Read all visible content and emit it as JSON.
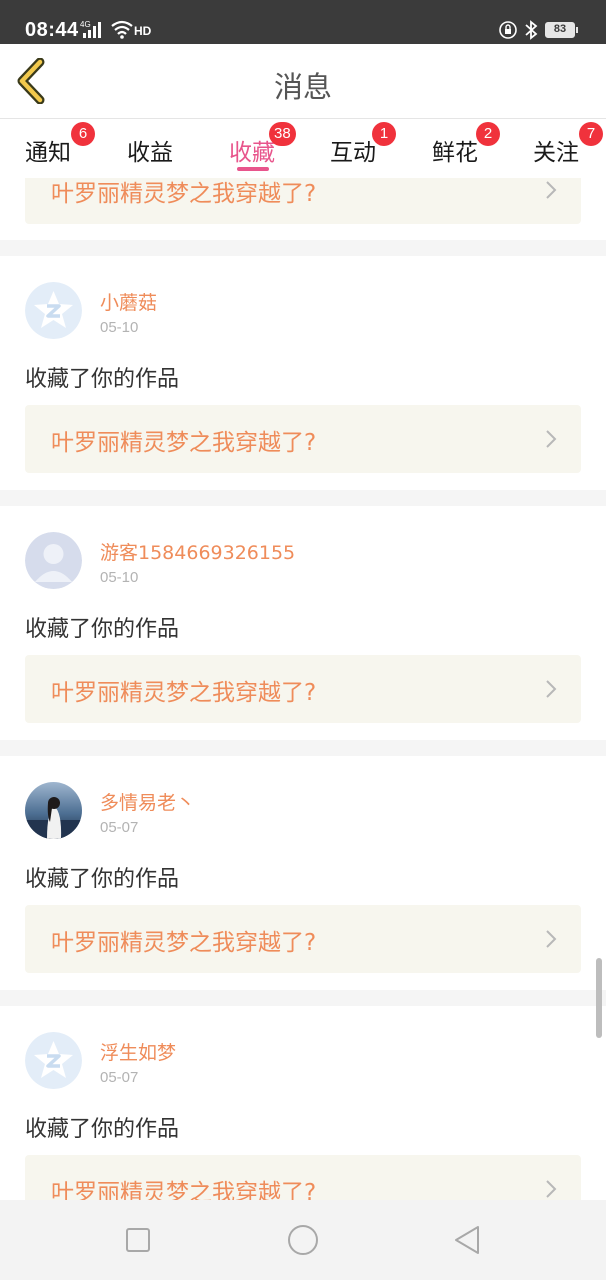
{
  "status_bar": {
    "time": "08:44",
    "network": "4G",
    "hd_label": "HD",
    "battery": "83",
    "icons": [
      "signal-icon",
      "wifi-icon",
      "rotation-lock-icon",
      "bluetooth-icon",
      "battery-icon"
    ]
  },
  "header": {
    "title": "消息",
    "back_icon": "back-chevron-icon"
  },
  "tabs": [
    {
      "label": "通知",
      "badge": "6",
      "active": false
    },
    {
      "label": "收益",
      "badge": "",
      "active": false
    },
    {
      "label": "收藏",
      "badge": "38",
      "active": true
    },
    {
      "label": "互动",
      "badge": "1",
      "active": false
    },
    {
      "label": "鲜花",
      "badge": "2",
      "active": false
    },
    {
      "label": "关注",
      "badge": "7",
      "active": false
    }
  ],
  "top_partial_item": {
    "work_title": "叶罗丽精灵梦之我穿越了?"
  },
  "items": [
    {
      "user": "小蘑菇",
      "date": "05-10",
      "action": "收藏了你的作品",
      "work_title": "叶罗丽精灵梦之我穿越了?",
      "avatar": "default-star-avatar"
    },
    {
      "user": "游客1584669326155",
      "date": "05-10",
      "action": "收藏了你的作品",
      "work_title": "叶罗丽精灵梦之我穿越了?",
      "avatar": "default-person-avatar"
    },
    {
      "user": "多情易老丶",
      "date": "05-07",
      "action": "收藏了你的作品",
      "work_title": "叶罗丽精灵梦之我穿越了?",
      "avatar": "photo-avatar"
    },
    {
      "user": "浮生如梦",
      "date": "05-07",
      "action": "收藏了你的作品",
      "work_title": "叶罗丽精灵梦之我穿越了?",
      "avatar": "default-star-avatar"
    }
  ],
  "colors": {
    "accent": "#e8558c",
    "badge": "#f0323c",
    "username": "#ef8c5a",
    "work_box": "#f7f6ee",
    "status_bar": "#3b3b3b"
  },
  "nav_bar": {
    "icons": [
      "recent-apps-icon",
      "home-icon",
      "back-icon"
    ]
  }
}
